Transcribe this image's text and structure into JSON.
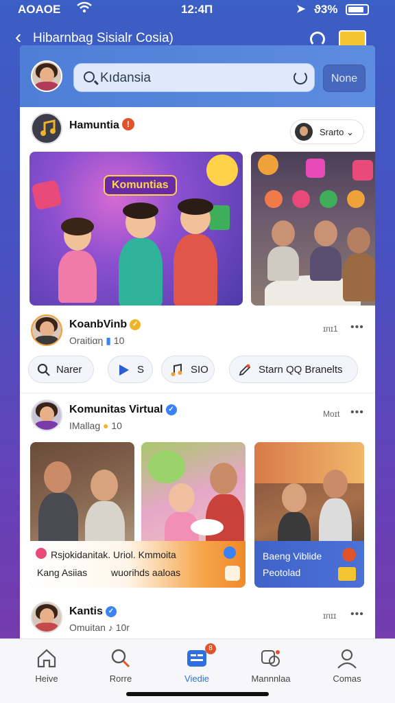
{
  "status_bar": {
    "carrier": "AOAOE",
    "time": "12:4П",
    "battery_text": "ϑ3%"
  },
  "header": {
    "back_glyph": "‹",
    "title": "Hibarnbag Sisialr Cosia)"
  },
  "search": {
    "value": "Kıdansia",
    "button_label": "None"
  },
  "posts": [
    {
      "name": "Hamuntia",
      "badge": "!",
      "source_chip": "Srarto ⌄",
      "stage_banner": "Komuntias"
    },
    {
      "name": "KoanbVinb",
      "sub": "Oraitiαη",
      "sub_count": "10",
      "time": "ɪᴨɪ1",
      "more": "•••"
    },
    {
      "name": "Komunitas Virtual",
      "sub": "IMallag",
      "sub_count": "10",
      "time": "Moɪt",
      "more": "•••",
      "caption_left_line1": "Rsjokidanitak. Uriol. Kmmoita",
      "caption_left_line2": "Kang Asiias",
      "caption_left_line2b": "wuorihds aaloas",
      "caption_right_line1": "Baeng Viblide",
      "caption_right_line2": "Peotolad"
    },
    {
      "name": "Kantis",
      "sub": "Omuitan",
      "sub_count": "10r",
      "time": "ɪᴨɪɪ",
      "more": "•••"
    }
  ],
  "chips": [
    {
      "label": "Narer",
      "icon": "search-icon"
    },
    {
      "label": "S",
      "icon": "play-icon"
    },
    {
      "label": "SIO",
      "icon": "music-note-icon"
    },
    {
      "label": "Starn QQ Branelts",
      "icon": "pencil-icon"
    }
  ],
  "tabs": [
    {
      "label": "Heive",
      "icon": "home-icon"
    },
    {
      "label": "Rorre",
      "icon": "search-icon"
    },
    {
      "label": "Viedie",
      "icon": "feed-icon",
      "active": true,
      "badge": "8"
    },
    {
      "label": "Mannnlaa",
      "icon": "people-icon"
    },
    {
      "label": "Comas",
      "icon": "profile-icon"
    }
  ],
  "colors": {
    "accent": "#2f6fe0",
    "header_bg": "#4e7ed6",
    "badge_red": "#e2532b",
    "badge_blue": "#3b82f6"
  }
}
